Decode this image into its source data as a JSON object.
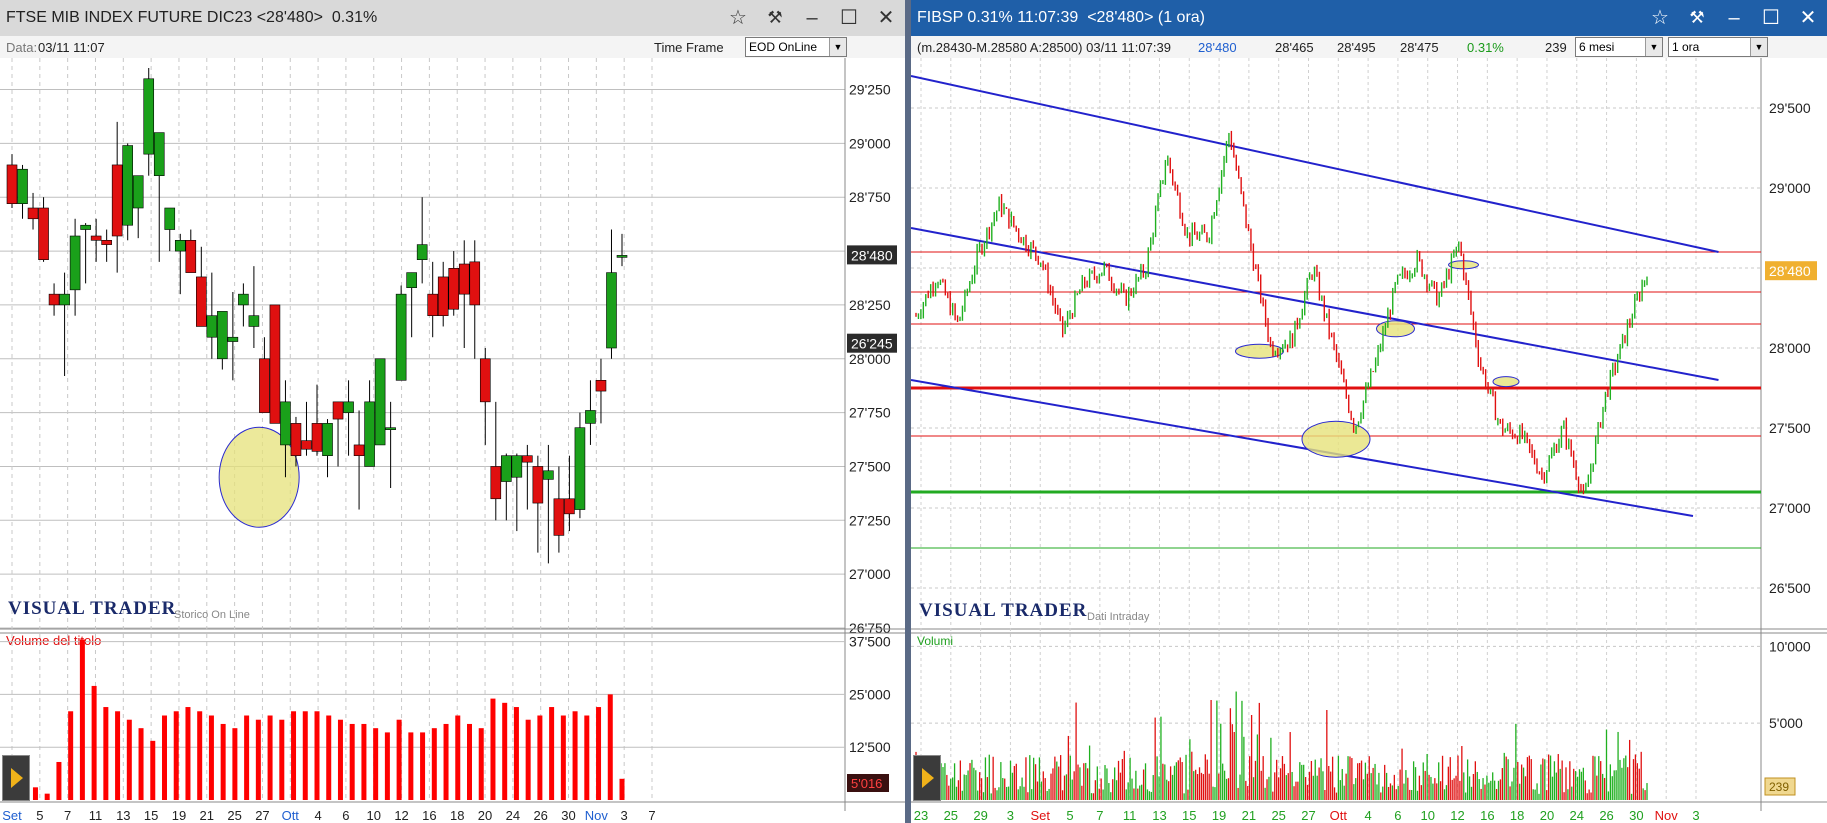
{
  "left": {
    "title": "FTSE MIB INDEX FUTURE DIC23 <28'480>  0.31%",
    "data_label": "Data:",
    "data_value": "03/11 11:07",
    "timeframe_label": "Time Frame",
    "timeframe_value": "EOD OnLine",
    "brand": "VISUAL TRADER",
    "brand_sub": "Storico On Line",
    "volume_label": "Volume del titolo",
    "last_price_tag": "28'480",
    "secondary_tag": "26'245",
    "volume_tag": "5'016",
    "colors": {
      "up": "#1aa01a",
      "down": "#e01010",
      "price_tag_bg": "#2b2b2b",
      "volume": "#ff0000",
      "highlight": "#e6e27a",
      "grid": "#bfbfbf"
    },
    "price_ticks": [
      "29'250",
      "29'000",
      "28'750",
      "28'500",
      "28'250",
      "28'000",
      "27'750",
      "27'500",
      "27'250",
      "27'000",
      "26'750"
    ],
    "volume_ticks": [
      "37'500",
      "25'000",
      "12'500"
    ],
    "x_labels": [
      "Set",
      "5",
      "7",
      "11",
      "13",
      "15",
      "19",
      "21",
      "25",
      "27",
      "Ott",
      "4",
      "6",
      "10",
      "12",
      "16",
      "18",
      "20",
      "24",
      "26",
      "30",
      "Nov",
      "3",
      "7"
    ]
  },
  "right": {
    "title": "FIBSP 0.31% 11:07:39  <28'480> (1 ora)",
    "quote_prefix": "(m.28430-M.28580 A:28500) 03/11 11:07:39",
    "quote_last": "28'480",
    "quote_open": "28'465",
    "quote_high": "28'495",
    "quote_low": "28'475",
    "quote_change": "0.31%",
    "quote_count": "239",
    "period_value": "6 mesi",
    "interval_value": "1 ora",
    "brand": "VISUAL TRADER",
    "brand_sub": "Dati Intraday",
    "volume_label": "Volumi",
    "last_price_tag": "28'480",
    "volume_tag": "239",
    "colors": {
      "up": "#20b020",
      "down": "#e01010",
      "price_tag_bg": "#f0b030",
      "trend": "#2222cc",
      "support": "#e01010",
      "green_level": "#22aa22",
      "highlight": "#e6e27a"
    },
    "price_ticks": [
      "29'500",
      "29'000",
      "28'500",
      "28'000",
      "27'500",
      "27'000",
      "26'500"
    ],
    "volume_ticks": [
      "10'000",
      "5'000"
    ],
    "x_labels": [
      "23",
      "25",
      "29",
      "3",
      "Set",
      "5",
      "7",
      "11",
      "13",
      "15",
      "19",
      "21",
      "25",
      "27",
      "Ott",
      "4",
      "6",
      "10",
      "12",
      "16",
      "18",
      "20",
      "24",
      "26",
      "30",
      "Nov",
      "3"
    ]
  },
  "chart_data": [
    {
      "type": "candlestick",
      "title": "FTSE MIB INDEX FUTURE DIC23",
      "ylim": [
        26750,
        29350
      ],
      "categories": [
        "Set",
        "5",
        "7",
        "11",
        "13",
        "15",
        "19",
        "21",
        "25",
        "27",
        "Ott",
        "4",
        "6",
        "10",
        "12",
        "16",
        "18",
        "20",
        "24",
        "26",
        "30",
        "Nov",
        "3"
      ],
      "ohlc": [
        [
          28900,
          28950,
          28700,
          28720
        ],
        [
          28720,
          28900,
          28650,
          28880
        ],
        [
          28700,
          28770,
          28600,
          28650
        ],
        [
          28700,
          28750,
          28450,
          28460
        ],
        [
          28300,
          28350,
          28200,
          28250
        ],
        [
          28250,
          28400,
          27920,
          28300
        ],
        [
          28320,
          28650,
          28200,
          28570
        ],
        [
          28600,
          28630,
          28350,
          28620
        ],
        [
          28570,
          28650,
          28450,
          28550
        ],
        [
          28550,
          28600,
          28450,
          28530
        ],
        [
          28900,
          29100,
          28400,
          28570
        ],
        [
          28620,
          29000,
          28550,
          28990
        ],
        [
          28700,
          28840,
          28560,
          28850
        ],
        [
          28950,
          29350,
          28850,
          29300
        ],
        [
          28850,
          29050,
          28450,
          29050
        ],
        [
          28600,
          28700,
          28500,
          28700
        ],
        [
          28500,
          28580,
          28300,
          28550
        ],
        [
          28550,
          28600,
          28450,
          28400
        ],
        [
          28380,
          28520,
          28200,
          28150
        ],
        [
          28100,
          28400,
          28000,
          28200
        ],
        [
          28000,
          28200,
          27950,
          28220
        ],
        [
          28080,
          28310,
          27900,
          28100
        ],
        [
          28250,
          28350,
          28150,
          28300
        ],
        [
          28150,
          28430,
          28050,
          28200
        ],
        [
          28000,
          28100,
          27750,
          27750
        ],
        [
          28250,
          28100,
          27800,
          27700
        ],
        [
          27600,
          27900,
          27450,
          27800
        ],
        [
          27700,
          27730,
          27500,
          27550
        ],
        [
          27620,
          27800,
          27550,
          27580
        ],
        [
          27700,
          27880,
          27550,
          27570
        ],
        [
          27550,
          27720,
          27450,
          27700
        ],
        [
          27800,
          27800,
          27500,
          27720
        ],
        [
          27750,
          27900,
          27550,
          27800
        ],
        [
          27600,
          27760,
          27300,
          27550
        ],
        [
          27500,
          27900,
          27600,
          27800
        ],
        [
          27600,
          28000,
          27650,
          28000
        ],
        [
          27680,
          27800,
          27400,
          27680
        ],
        [
          27900,
          28340,
          27950,
          28300
        ],
        [
          28330,
          28400,
          28100,
          28400
        ],
        [
          28460,
          28750,
          28350,
          28530
        ],
        [
          28300,
          28450,
          28100,
          28200
        ],
        [
          28380,
          28450,
          28150,
          28200
        ],
        [
          28420,
          28500,
          28200,
          28230
        ],
        [
          28440,
          28550,
          28050,
          28300
        ],
        [
          28450,
          28550,
          28000,
          28250
        ],
        [
          28000,
          28050,
          27600,
          27800
        ],
        [
          27500,
          27800,
          27250,
          27350
        ],
        [
          27430,
          27560,
          27250,
          27550
        ],
        [
          27450,
          27560,
          27200,
          27550
        ],
        [
          27550,
          27600,
          27300,
          27520
        ],
        [
          27500,
          27550,
          27100,
          27330
        ],
        [
          27440,
          27600,
          27050,
          27480
        ],
        [
          27350,
          27500,
          27100,
          27180
        ],
        [
          27350,
          27550,
          27200,
          27280
        ],
        [
          27300,
          27750,
          27260,
          27680
        ],
        [
          27700,
          27900,
          27600,
          27760
        ],
        [
          27900,
          28000,
          27700,
          27850
        ],
        [
          28050,
          28600,
          28000,
          28400
        ],
        [
          28480,
          28580,
          28430,
          28480
        ]
      ],
      "volume_ylim": [
        0,
        40000
      ],
      "volume": [
        2000,
        2500,
        3000,
        1500,
        9000,
        21000,
        38000,
        27000,
        22000,
        21000,
        19000,
        17000,
        14000,
        20000,
        21000,
        22000,
        21000,
        20000,
        18000,
        17000,
        20000,
        19000,
        20000,
        19000,
        21000,
        21000,
        21000,
        20000,
        19000,
        18000,
        18000,
        17000,
        16000,
        19000,
        16000,
        16000,
        17000,
        18000,
        20000,
        18000,
        17000,
        24000,
        23000,
        22000,
        19000,
        20000,
        22000,
        20000,
        21000,
        20000,
        22000,
        25000,
        5016
      ]
    },
    {
      "type": "candlestick",
      "title": "FIBSP",
      "ylim": [
        26250,
        29750
      ],
      "categories": [
        "23",
        "25",
        "29",
        "3",
        "Set",
        "5",
        "7",
        "11",
        "13",
        "15",
        "19",
        "21",
        "25",
        "27",
        "Ott",
        "4",
        "6",
        "10",
        "12",
        "16",
        "18",
        "20",
        "24",
        "26",
        "30",
        "Nov",
        "3"
      ],
      "key_points": [
        28200,
        28450,
        28150,
        28600,
        28900,
        28700,
        28550,
        28100,
        28400,
        28500,
        28300,
        28500,
        29200,
        28700,
        28700,
        29350,
        28650,
        28000,
        28050,
        28500,
        28000,
        27500,
        27900,
        28400,
        28550,
        28300,
        28650,
        27900,
        27500,
        27450,
        27200,
        27500,
        27050,
        27700,
        28100,
        28480
      ],
      "trendlines": [
        {
          "from": [
            0,
            29700
          ],
          "to": [
            0.95,
            28600
          ]
        },
        {
          "from": [
            0,
            28750
          ],
          "to": [
            0.95,
            27800
          ]
        },
        {
          "from": [
            0,
            27800
          ],
          "to": [
            0.92,
            26950
          ]
        }
      ],
      "horizontal_levels": [
        28600,
        28350,
        28150,
        27750,
        27450,
        27100,
        26750
      ],
      "volume_ylim": [
        0,
        11000
      ],
      "volume_last": 239
    }
  ]
}
